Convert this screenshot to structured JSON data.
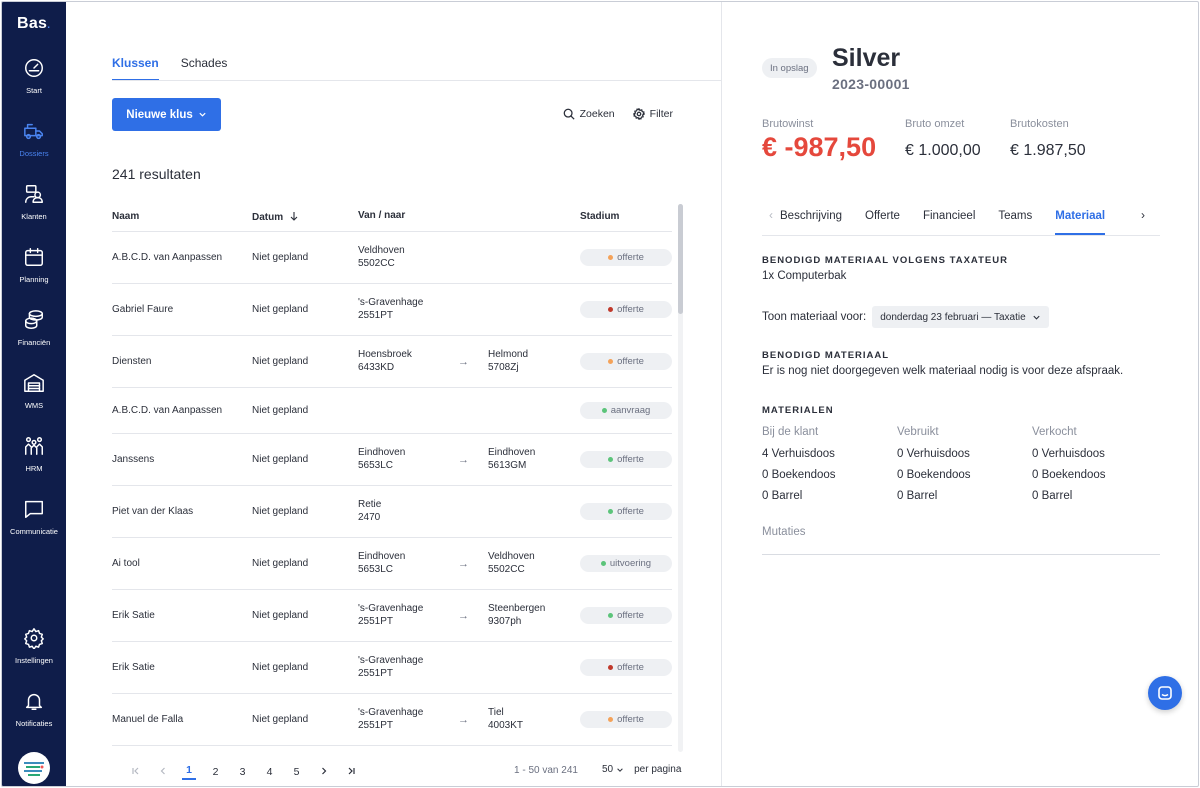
{
  "sidebar": {
    "logo": "Bas",
    "logo_dot": ".",
    "items": [
      {
        "label": "Start",
        "icon": "gauge-icon"
      },
      {
        "label": "Dossiers",
        "icon": "truck-icon"
      },
      {
        "label": "Klanten",
        "icon": "users-icon"
      },
      {
        "label": "Planning",
        "icon": "calendar-icon"
      },
      {
        "label": "Financiën",
        "icon": "coins-icon"
      },
      {
        "label": "WMS",
        "icon": "warehouse-icon"
      },
      {
        "label": "HRM",
        "icon": "team-icon"
      },
      {
        "label": "Communicatie",
        "icon": "chat-icon"
      }
    ],
    "bottom": [
      {
        "label": "Instellingen",
        "icon": "gear-icon"
      },
      {
        "label": "Notificaties",
        "icon": "bell-icon"
      }
    ],
    "active_color": "#4a84f0",
    "bg_color": "#0f1d4a"
  },
  "list": {
    "tabs": [
      "Klussen",
      "Schades"
    ],
    "new_button": "Nieuwe klus",
    "search_label": "Zoeken",
    "filter_label": "Filter",
    "results_count": "241 resultaten",
    "columns": {
      "name": "Naam",
      "date": "Datum",
      "route": "Van / naar",
      "stage": "Stadium"
    },
    "rows": [
      {
        "name": "A.B.C.D. van Aanpassen",
        "date": "Niet gepland",
        "from1": "Veldhoven",
        "from2": "5502CC",
        "to1": "",
        "to2": "",
        "stage": "offerte",
        "dot": "#f4a259"
      },
      {
        "name": "Gabriel Faure",
        "date": "Niet gepland",
        "from1": "'s-Gravenhage",
        "from2": "2551PT",
        "to1": "",
        "to2": "",
        "stage": "offerte",
        "dot": "#c0392b"
      },
      {
        "name": "Diensten",
        "date": "Niet gepland",
        "from1": "Hoensbroek",
        "from2": "6433KD",
        "to1": "Helmond",
        "to2": "5708Zj",
        "stage": "offerte",
        "dot": "#f4a259"
      },
      {
        "name": "A.B.C.D. van Aanpassen",
        "date": "Niet gepland",
        "from1": "",
        "from2": "",
        "to1": "",
        "to2": "",
        "stage": "aanvraag",
        "dot": "#5cc47a"
      },
      {
        "name": "Janssens",
        "date": "Niet gepland",
        "from1": "Eindhoven",
        "from2": "5653LC",
        "to1": "Eindhoven",
        "to2": "5613GM",
        "stage": "offerte",
        "dot": "#5cc47a"
      },
      {
        "name": "Piet van der Klaas",
        "date": "Niet gepland",
        "from1": "Retie",
        "from2": "2470",
        "to1": "",
        "to2": "",
        "stage": "offerte",
        "dot": "#5cc47a"
      },
      {
        "name": "Ai tool",
        "date": "Niet gepland",
        "from1": "Eindhoven",
        "from2": "5653LC",
        "to1": "Veldhoven",
        "to2": "5502CC",
        "stage": "uitvoering",
        "dot": "#5cc47a"
      },
      {
        "name": "Erik Satie",
        "date": "Niet gepland",
        "from1": "'s-Gravenhage",
        "from2": "2551PT",
        "to1": "Steenbergen",
        "to2": "9307ph",
        "stage": "offerte",
        "dot": "#5cc47a"
      },
      {
        "name": "Erik Satie",
        "date": "Niet gepland",
        "from1": "'s-Gravenhage",
        "from2": "2551PT",
        "to1": "",
        "to2": "",
        "stage": "offerte",
        "dot": "#c0392b"
      },
      {
        "name": "Manuel de Falla",
        "date": "Niet gepland",
        "from1": "'s-Gravenhage",
        "from2": "2551PT",
        "to1": "Tiel",
        "to2": "4003KT",
        "stage": "offerte",
        "dot": "#f4a259"
      }
    ],
    "pager": {
      "pages": [
        "1",
        "2",
        "3",
        "4",
        "5"
      ],
      "active": "1",
      "info": "1 - 50 van 241",
      "per_page": "50",
      "per_page_label": "per pagina"
    }
  },
  "detail": {
    "status": "In opslag",
    "title": "Silver",
    "subtitle": "2023-00001",
    "brutowinst_label": "Brutowinst",
    "brutowinst_value": "€ -987,50",
    "omzet_label": "Bruto omzet",
    "omzet_value": "€ 1.000,00",
    "kosten_label": "Brutokosten",
    "kosten_value": "€ 1.987,50",
    "tabs": [
      "Beschrijving",
      "Offerte",
      "Financieel",
      "Teams",
      "Materiaal"
    ],
    "active_tab": "Materiaal",
    "sec1_title": "BENODIGD MATERIAAL VOLGENS TAXATEUR",
    "sec1_text": "1x Computerbak",
    "toon_label": "Toon materiaal voor:",
    "toon_value": "donderdag 23 februari — Taxatie",
    "sec2_title": "BENODIGD MATERIAAL",
    "sec2_text": "Er is nog niet doorgegeven welk materiaal nodig is voor deze afspraak.",
    "sec3_title": "MATERIALEN",
    "materials": [
      {
        "header": "Bij de klant",
        "items": [
          "4 Verhuisdoos",
          "0 Boekendoos",
          "0 Barrel"
        ]
      },
      {
        "header": "Vebruikt",
        "items": [
          "0 Verhuisdoos",
          "0 Boekendoos",
          "0 Barrel"
        ]
      },
      {
        "header": "Verkocht",
        "items": [
          "0 Verhuisdoos",
          "0 Boekendoos",
          "0 Barrel"
        ]
      }
    ],
    "mutaties": "Mutaties",
    "accent_color": "#2f6fe6",
    "negative_color": "#e5483c"
  }
}
